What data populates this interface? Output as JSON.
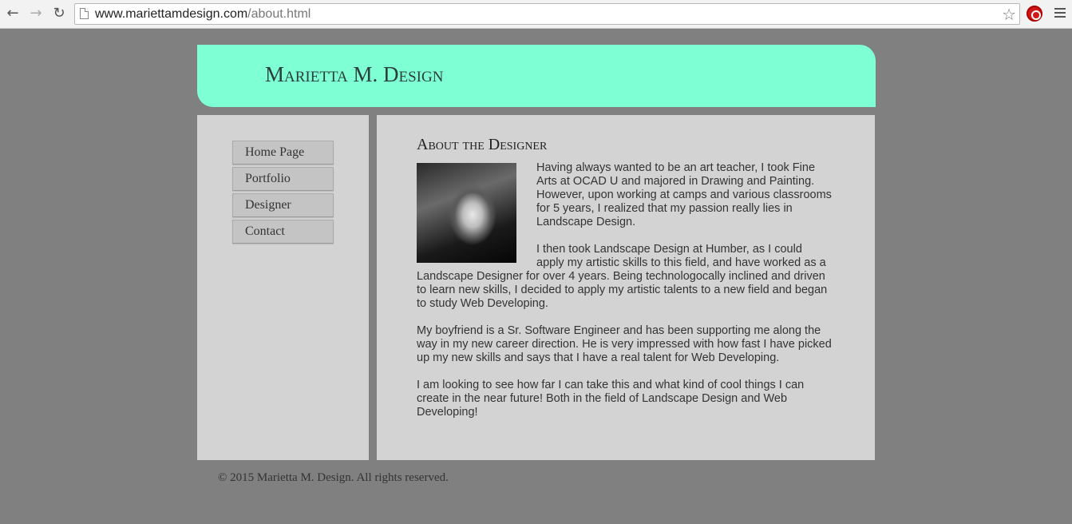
{
  "browser": {
    "url_host": "www.mariettamdesign.com",
    "url_path": "/about.html"
  },
  "header": {
    "title": "Marietta M. Design",
    "color": "#7fffd4"
  },
  "nav": {
    "items": [
      {
        "label": "Home Page"
      },
      {
        "label": "Portfolio"
      },
      {
        "label": "Designer"
      },
      {
        "label": "Contact"
      }
    ]
  },
  "content": {
    "heading": "About the Designer",
    "paragraphs": [
      "Having always wanted to be an art teacher, I took Fine Arts at OCAD U and majored in Drawing and Painting. However, upon working at camps and various classrooms for 5 years, I realized that my passion really lies in Landscape Design.",
      "I then took Landscape Design at Humber, as I could apply my artistic skills to this field, and have worked as a Landscape Designer for over 4 years. Being technologocally inclined and driven to learn new skills, I decided to apply my artistic talents to a new field and began to study Web Developing.",
      "My boyfriend is a Sr. Software Engineer and has been supporting me along the way in my new career direction. He is very impressed with how fast I have picked up my new skills and says that I have a real talent for Web Developing.",
      "I am looking to see how far I can take this and what kind of cool things I can create in the near future! Both in the field of Landscape Design and Web Developing!"
    ]
  },
  "footer": {
    "text": "© 2015 Marietta M. Design. All rights reserved."
  }
}
